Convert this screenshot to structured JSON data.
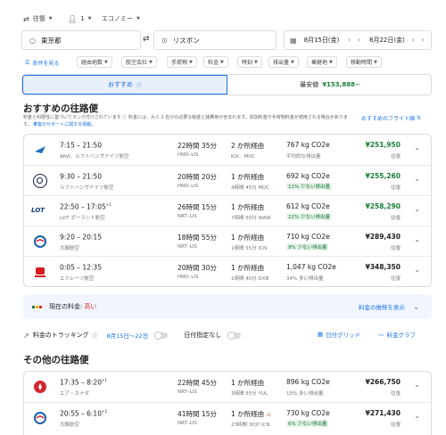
{
  "top": {
    "trip_type": "往復",
    "passengers": "1",
    "cabin": "エコノミー"
  },
  "search": {
    "origin": "東京都",
    "destination": "リスボン",
    "depart": "8月15日(金)",
    "return": "8月22日(金)"
  },
  "filters": {
    "all_filters": "条件を見る",
    "stops": "経由地数",
    "airlines": "航空会社",
    "bags": "手荷物",
    "price": "料金",
    "times": "時刻",
    "emissions": "排出量",
    "connecting": "乗継地",
    "duration": "移動時間"
  },
  "tabs": {
    "best": "おすすめ",
    "cheapest": "最安値",
    "cheapest_price": "¥153,888~"
  },
  "best_section": {
    "title": "おすすめの往路便",
    "note": "料金と利便性に基づいてランク付けされています",
    "note2": "料金には、大人 1 名分の必要な税金と諸費用が含まれます。追加料金や手荷物料金が適用される場合があります。",
    "note3": "乗客のサポートに関する情報。",
    "link": "おすすめのフライト順"
  },
  "flights": [
    {
      "time": "7:15 – 21:50",
      "plus": "",
      "airline": "ANA、ルフトハンザドイツ航空",
      "duration": "22時間 35分",
      "route": "HND–LIS",
      "stops": "2 か所経由",
      "stops_detail": "KIX、MUC",
      "co2": "767 kg CO2e",
      "co2_note": "平均的な排出量",
      "price": "¥251,950",
      "price_note": "往復",
      "logo_color": "#1e73be"
    },
    {
      "time": "9:30 – 21:50",
      "plus": "",
      "airline": "ルフトハンザドイツ航空",
      "duration": "20時間 20分",
      "route": "HND–LIS",
      "stops": "1 か所経由",
      "stops_detail": "4時間 45分 MUC",
      "co2": "692 kg CO2e",
      "co2_note": "11% 少ない排出量",
      "price": "¥255,260",
      "price_note": "往復",
      "logo_color": "#0a1d3d"
    },
    {
      "time": "22:50 – 17:05",
      "plus": "+1",
      "airline": "LOT ポーランド航空",
      "duration": "26時間 15分",
      "route": "NRT–LIS",
      "stops": "1 か所経由",
      "stops_detail": "7時間 50分 WAW",
      "co2": "612 kg CO2e",
      "co2_note": "22% 少ない排出量",
      "price": "¥258,290",
      "price_note": "往復",
      "logo_color": "#0b3a7e"
    },
    {
      "time": "9:20 – 20:15",
      "plus": "",
      "airline": "大韓航空",
      "duration": "18時間 55分",
      "route": "NRT–LIS",
      "stops": "1 か所経由",
      "stops_detail": "1時間 55分 ICN",
      "co2": "710 kg CO2e",
      "co2_note": "9% 少ない排出量",
      "price": "¥289,430",
      "price_note": "往復",
      "logo_color": "#1c5fa8"
    },
    {
      "time": "0:05 – 12:35",
      "plus": "",
      "airline": "エミレーツ航空",
      "duration": "20時間 30分",
      "route": "HND–LIS",
      "stops": "1 か所経由",
      "stops_detail": "1時間 40分 DXB",
      "co2": "1,047 kg CO2e",
      "co2_note": "34% 多い排出量",
      "price": "¥348,350",
      "price_note": "往復",
      "logo_color": "#d71921"
    }
  ],
  "price_insight": {
    "label": "現在の料金:",
    "level": "高い",
    "link": "料金の推移を表示"
  },
  "tracking": {
    "label": "料金のトラッキング",
    "dates": "8月15日～22日",
    "any_dates": "日付指定なし",
    "date_grid": "日付グリッド",
    "price_graph": "料金グラフ"
  },
  "other_section": {
    "title": "その他の往路便"
  },
  "other_flights": [
    {
      "time": "17:35 – 8:20",
      "plus": "+1",
      "airline": "エア・カナダ",
      "duration": "22時間 45分",
      "route": "NRT–LIS",
      "stops": "1 か所経由",
      "stops_detail": "3時間 55分 YUL",
      "co2": "896 kg CO2e",
      "co2_note": "15% 多い排出量",
      "price": "¥266,750",
      "price_note": "往復",
      "logo_color": "#d22630"
    },
    {
      "time": "20:55 – 6:10",
      "plus": "+2",
      "airline": "大韓航空",
      "duration": "41時間 15分",
      "route": "NRT–LIS",
      "stops": "1 か所経由",
      "stops_detail": "23時間 30分 ICN",
      "co2": "730 kg CO2e",
      "co2_note": "6% 少ない排出量",
      "price": "¥271,430",
      "price_note": "往復",
      "logo_color": "#1c5fa8"
    }
  ]
}
